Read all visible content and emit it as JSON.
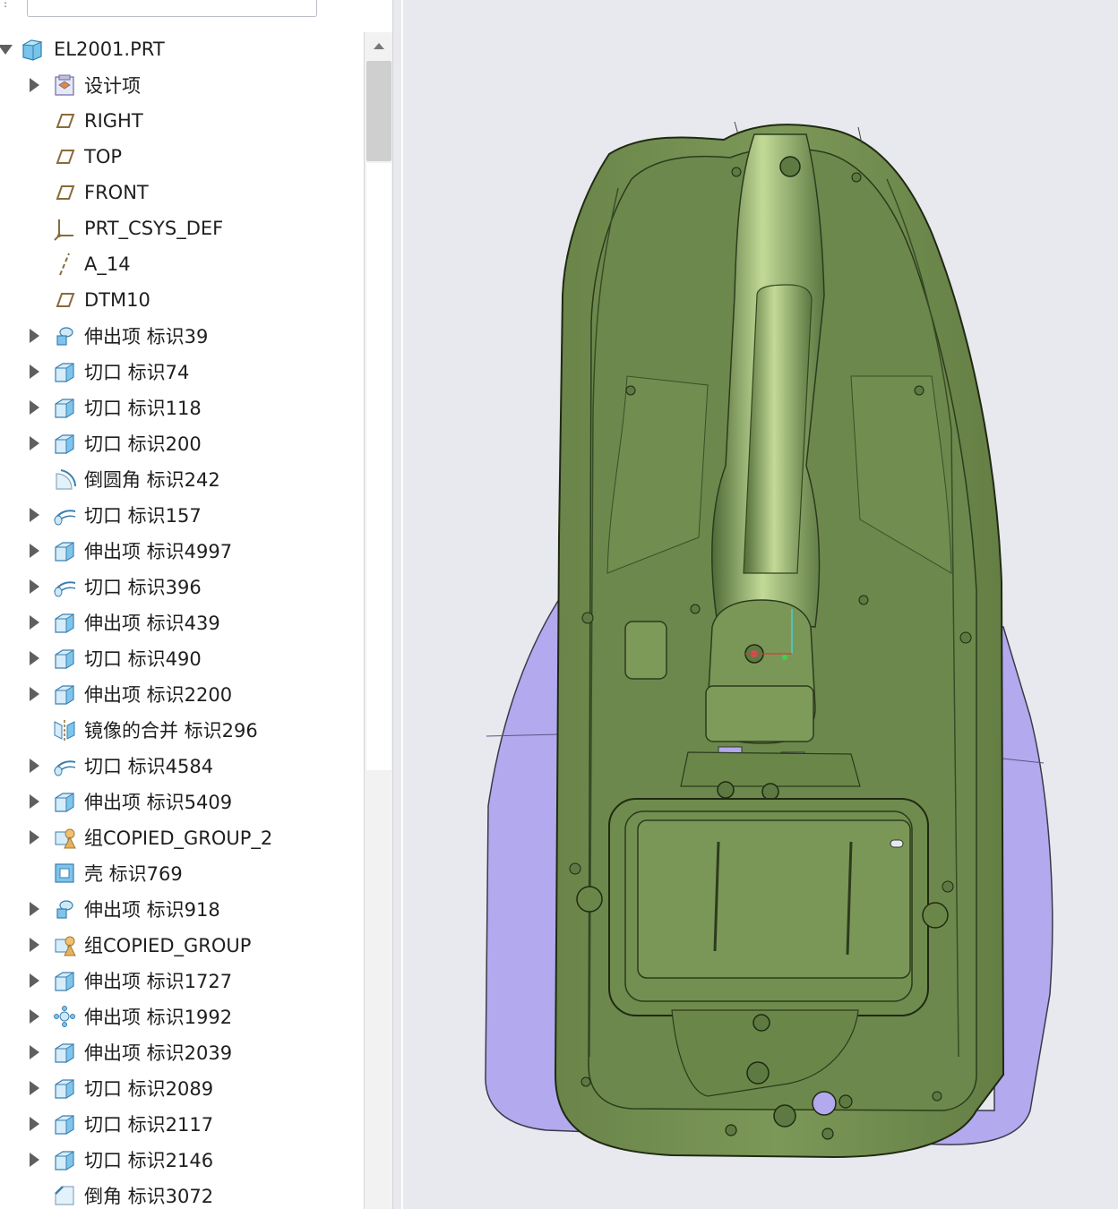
{
  "model_tree": {
    "root": {
      "label": "EL2001.PRT",
      "icon": "part-icon"
    },
    "items": [
      {
        "label": "设计项",
        "icon": "design-items-icon",
        "expandable": true
      },
      {
        "label": "RIGHT",
        "icon": "datum-plane-icon",
        "expandable": false
      },
      {
        "label": "TOP",
        "icon": "datum-plane-icon",
        "expandable": false
      },
      {
        "label": "FRONT",
        "icon": "datum-plane-icon",
        "expandable": false
      },
      {
        "label": "PRT_CSYS_DEF",
        "icon": "coordinate-system-icon",
        "expandable": false
      },
      {
        "label": "A_14",
        "icon": "datum-axis-icon",
        "expandable": false
      },
      {
        "label": "DTM10",
        "icon": "datum-plane-icon",
        "expandable": false
      },
      {
        "label": "伸出项 标识39",
        "icon": "revolve-icon",
        "expandable": true
      },
      {
        "label": "切口 标识74",
        "icon": "extrude-icon",
        "expandable": true
      },
      {
        "label": "切口 标识118",
        "icon": "extrude-icon",
        "expandable": true
      },
      {
        "label": "切口 标识200",
        "icon": "extrude-icon",
        "expandable": true
      },
      {
        "label": "倒圆角 标识242",
        "icon": "round-icon",
        "expandable": false
      },
      {
        "label": "切口 标识157",
        "icon": "sweep-icon",
        "expandable": true
      },
      {
        "label": "伸出项 标识4997",
        "icon": "extrude-icon",
        "expandable": true
      },
      {
        "label": "切口 标识396",
        "icon": "sweep-icon",
        "expandable": true
      },
      {
        "label": "伸出项 标识439",
        "icon": "extrude-icon",
        "expandable": true
      },
      {
        "label": "切口 标识490",
        "icon": "extrude-icon",
        "expandable": true
      },
      {
        "label": "伸出项 标识2200",
        "icon": "extrude-icon",
        "expandable": true
      },
      {
        "label": "镜像的合并 标识296",
        "icon": "mirror-icon",
        "expandable": false
      },
      {
        "label": "切口 标识4584",
        "icon": "sweep-icon",
        "expandable": true
      },
      {
        "label": "伸出项 标识5409",
        "icon": "extrude-icon",
        "expandable": true
      },
      {
        "label": "组COPIED_GROUP_2",
        "icon": "group-icon",
        "expandable": true
      },
      {
        "label": "壳 标识769",
        "icon": "shell-icon",
        "expandable": false
      },
      {
        "label": "伸出项 标识918",
        "icon": "revolve-icon",
        "expandable": true
      },
      {
        "label": "组COPIED_GROUP",
        "icon": "group-icon",
        "expandable": true
      },
      {
        "label": "伸出项 标识1727",
        "icon": "extrude-icon",
        "expandable": true
      },
      {
        "label": "伸出项 标识1992",
        "icon": "pattern-icon",
        "expandable": true
      },
      {
        "label": "伸出项 标识2039",
        "icon": "extrude-icon",
        "expandable": true
      },
      {
        "label": "切口 标识2089",
        "icon": "extrude-icon",
        "expandable": true
      },
      {
        "label": "切口 标识2117",
        "icon": "extrude-icon",
        "expandable": true
      },
      {
        "label": "切口 标识2146",
        "icon": "extrude-icon",
        "expandable": true
      },
      {
        "label": "倒角 标识3072",
        "icon": "chamfer-icon",
        "expandable": false
      }
    ]
  },
  "colors": {
    "model_green": "#6f8a4e",
    "model_highlight": "#b9d08f",
    "model_shadow": "#4d6535",
    "tool_purple": "#b3a9ee",
    "viewport_bg": "#e8e9ee"
  },
  "viewport": {
    "content": "3D model view"
  }
}
